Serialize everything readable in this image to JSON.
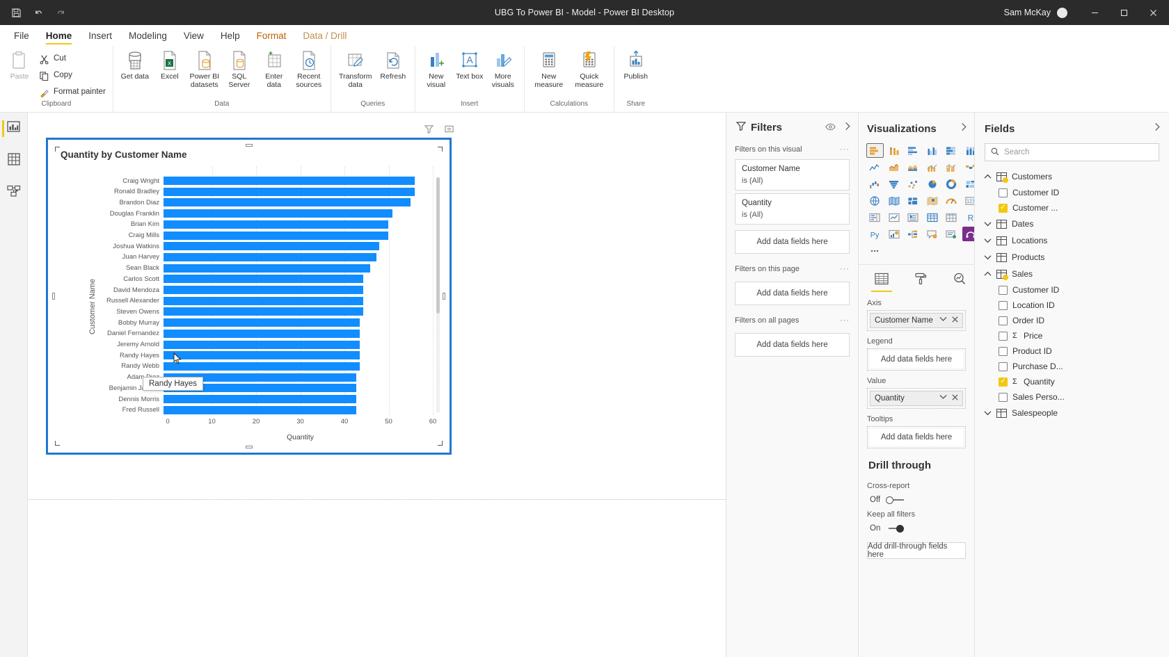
{
  "titlebar": {
    "save_icon": "save-icon",
    "undo_icon": "undo-icon",
    "redo_icon": "redo-icon",
    "title": "UBG To Power BI - Model - Power BI Desktop",
    "user": "Sam McKay",
    "minimize": "minimize-button",
    "restore": "restore-button",
    "close": "close-button"
  },
  "ribbon": {
    "tabs": [
      {
        "label": "File",
        "state": "normal"
      },
      {
        "label": "Home",
        "state": "active"
      },
      {
        "label": "Insert",
        "state": "normal"
      },
      {
        "label": "Modeling",
        "state": "normal"
      },
      {
        "label": "View",
        "state": "normal"
      },
      {
        "label": "Help",
        "state": "normal"
      },
      {
        "label": "Format",
        "state": "contextual"
      },
      {
        "label": "Data / Drill",
        "state": "contextual2"
      }
    ],
    "groups": [
      {
        "name": "Clipboard",
        "label": "Clipboard",
        "items": [
          {
            "label": "Paste",
            "icon": "paste-icon",
            "disabled": true
          },
          {
            "label": "Cut",
            "icon": "cut-icon"
          },
          {
            "label": "Copy",
            "icon": "copy-icon"
          },
          {
            "label": "Format painter",
            "icon": "format-painter-icon"
          }
        ]
      },
      {
        "name": "Data",
        "label": "Data",
        "items": [
          {
            "label": "Get data",
            "icon": "get-data-icon",
            "caret": true
          },
          {
            "label": "Excel",
            "icon": "excel-icon"
          },
          {
            "label": "Power BI datasets",
            "icon": "powerbi-datasets-icon"
          },
          {
            "label": "SQL Server",
            "icon": "sql-server-icon"
          },
          {
            "label": "Enter data",
            "icon": "enter-data-icon"
          },
          {
            "label": "Recent sources",
            "icon": "recent-sources-icon",
            "caret": true
          }
        ]
      },
      {
        "name": "Queries",
        "label": "Queries",
        "items": [
          {
            "label": "Transform data",
            "icon": "transform-data-icon",
            "caret": true
          },
          {
            "label": "Refresh",
            "icon": "refresh-icon"
          }
        ]
      },
      {
        "name": "Insert",
        "label": "Insert",
        "items": [
          {
            "label": "New visual",
            "icon": "new-visual-icon"
          },
          {
            "label": "Text box",
            "icon": "text-box-icon"
          },
          {
            "label": "More visuals",
            "icon": "more-visuals-icon",
            "caret": true
          }
        ]
      },
      {
        "name": "Calculations",
        "label": "Calculations",
        "items": [
          {
            "label": "New measure",
            "icon": "new-measure-icon"
          },
          {
            "label": "Quick measure",
            "icon": "quick-measure-icon"
          }
        ]
      },
      {
        "name": "Share",
        "label": "Share",
        "items": [
          {
            "label": "Publish",
            "icon": "publish-icon"
          }
        ]
      }
    ]
  },
  "viewbar": {
    "items": [
      {
        "name": "report-view",
        "icon": "report-icon",
        "active": true
      },
      {
        "name": "data-view",
        "icon": "table-icon",
        "active": false
      },
      {
        "name": "model-view",
        "icon": "model-icon",
        "active": false
      }
    ]
  },
  "visual": {
    "title": "Quantity by Customer Name",
    "tooltip": "Randy Hayes",
    "actions": [
      "filter-icon",
      "focus-mode-icon"
    ]
  },
  "chart_data": {
    "type": "bar",
    "orientation": "horizontal",
    "title": "Quantity by Customer Name",
    "xlabel": "Quantity",
    "ylabel": "Customer Name",
    "xlim": [
      0,
      60
    ],
    "xticks": [
      0,
      10,
      20,
      30,
      40,
      50,
      60
    ],
    "grid": true,
    "bar_color": "#118dff",
    "categories": [
      "Craig Wright",
      "Ronald Bradley",
      "Brandon Diaz",
      "Douglas Franklin",
      "Brian Kim",
      "Craig Mills",
      "Joshua Watkins",
      "Juan Harvey",
      "Sean Black",
      "Carlos Scott",
      "David Mendoza",
      "Russell Alexander",
      "Steven Owens",
      "Bobby Murray",
      "Daniel Fernandez",
      "Jeremy Arnold",
      "Randy Hayes",
      "Randy Webb",
      "Adam Diaz",
      "Benjamin Jacobs",
      "Dennis Morris",
      "Fred Russell"
    ],
    "values": [
      56,
      56,
      55,
      51,
      50,
      50,
      48,
      47.5,
      46,
      44.5,
      44.5,
      44.5,
      44.5,
      43.7,
      43.7,
      43.7,
      43.7,
      43.7,
      43,
      43,
      43,
      43
    ]
  },
  "filters": {
    "title": "Filters",
    "eye_icon": "eye-icon",
    "expand_icon": "chevron-right-icon",
    "sections": [
      {
        "label": "Filters on this visual",
        "cards": [
          {
            "field": "Customer Name",
            "condition": "is (All)"
          },
          {
            "field": "Quantity",
            "condition": "is (All)"
          }
        ],
        "dropzone": "Add data fields here"
      },
      {
        "label": "Filters on this page",
        "cards": [],
        "dropzone": "Add data fields here"
      },
      {
        "label": "Filters on all pages",
        "cards": [],
        "dropzone": "Add data fields here"
      }
    ]
  },
  "visualizations": {
    "title": "Visualizations",
    "expand_icon": "chevron-right-icon",
    "icons": [
      {
        "name": "stacked-bar-chart-icon",
        "selected": true
      },
      {
        "name": "stacked-column-chart-icon"
      },
      {
        "name": "clustered-bar-chart-icon"
      },
      {
        "name": "clustered-column-chart-icon"
      },
      {
        "name": "100-stacked-bar-chart-icon"
      },
      {
        "name": "100-stacked-column-chart-icon"
      },
      {
        "name": "line-chart-icon"
      },
      {
        "name": "area-chart-icon"
      },
      {
        "name": "stacked-area-chart-icon"
      },
      {
        "name": "line-stacked-column-chart-icon"
      },
      {
        "name": "line-clustered-column-chart-icon"
      },
      {
        "name": "ribbon-chart-icon"
      },
      {
        "name": "waterfall-chart-icon"
      },
      {
        "name": "funnel-chart-icon"
      },
      {
        "name": "scatter-chart-icon"
      },
      {
        "name": "pie-chart-icon"
      },
      {
        "name": "donut-chart-icon"
      },
      {
        "name": "treemap-icon"
      },
      {
        "name": "map-icon"
      },
      {
        "name": "filled-map-icon"
      },
      {
        "name": "shape-map-icon"
      },
      {
        "name": "azure-map-icon"
      },
      {
        "name": "gauge-icon"
      },
      {
        "name": "card-icon"
      },
      {
        "name": "multi-row-card-icon"
      },
      {
        "name": "kpi-icon"
      },
      {
        "name": "slicer-icon"
      },
      {
        "name": "table-icon"
      },
      {
        "name": "matrix-icon"
      },
      {
        "name": "r-script-visual-icon"
      },
      {
        "name": "python-visual-icon"
      },
      {
        "name": "key-influencers-icon"
      },
      {
        "name": "decomposition-tree-icon"
      },
      {
        "name": "qa-visual-icon"
      },
      {
        "name": "smart-narrative-icon"
      },
      {
        "name": "paginated-report-icon",
        "purple": true
      },
      {
        "name": "more-options-icon"
      }
    ],
    "tabs": [
      {
        "name": "fields-tab",
        "icon": "fields-icon",
        "active": true
      },
      {
        "name": "format-tab",
        "icon": "paint-roller-icon",
        "active": false
      },
      {
        "name": "analytics-tab",
        "icon": "magnifier-chart-icon",
        "active": false
      }
    ],
    "wells": [
      {
        "label": "Axis",
        "chip": "Customer Name",
        "empty": null
      },
      {
        "label": "Legend",
        "chip": null,
        "empty": "Add data fields here"
      },
      {
        "label": "Value",
        "chip": "Quantity",
        "empty": null
      },
      {
        "label": "Tooltips",
        "chip": null,
        "empty": "Add data fields here"
      }
    ],
    "drill_through": {
      "title": "Drill through",
      "cross_report_label": "Cross-report",
      "cross_report_state": "Off",
      "keep_filters_label": "Keep all filters",
      "keep_filters_state": "On",
      "dropzone": "Add drill-through fields here"
    }
  },
  "fields": {
    "title": "Fields",
    "expand_icon": "chevron-right-icon",
    "search_placeholder": "Search",
    "search_icon": "search-icon",
    "tables": [
      {
        "name": "Customers",
        "expanded": true,
        "highlighted": true,
        "fields": [
          {
            "label": "Customer ID",
            "checked": false,
            "measure": false
          },
          {
            "label": "Customer ...",
            "checked": true,
            "measure": false
          }
        ]
      },
      {
        "name": "Dates",
        "expanded": false,
        "highlighted": false,
        "fields": []
      },
      {
        "name": "Locations",
        "expanded": false,
        "highlighted": false,
        "fields": []
      },
      {
        "name": "Products",
        "expanded": false,
        "highlighted": false,
        "fields": []
      },
      {
        "name": "Sales",
        "expanded": true,
        "highlighted": true,
        "fields": [
          {
            "label": "Customer ID",
            "checked": false,
            "measure": false
          },
          {
            "label": "Location ID",
            "checked": false,
            "measure": false
          },
          {
            "label": "Order ID",
            "checked": false,
            "measure": false
          },
          {
            "label": "Price",
            "checked": false,
            "measure": true
          },
          {
            "label": "Product ID",
            "checked": false,
            "measure": false
          },
          {
            "label": "Purchase D...",
            "checked": false,
            "measure": false
          },
          {
            "label": "Quantity",
            "checked": true,
            "measure": true
          },
          {
            "label": "Sales Perso...",
            "checked": false,
            "measure": false
          }
        ]
      },
      {
        "name": "Salespeople",
        "expanded": false,
        "highlighted": false,
        "fields": []
      }
    ]
  },
  "colors": {
    "accent_yellow": "#f2c811",
    "bar_blue": "#118dff",
    "selection_blue": "#1f78d1",
    "titlebar_bg": "#2b2b2b"
  }
}
